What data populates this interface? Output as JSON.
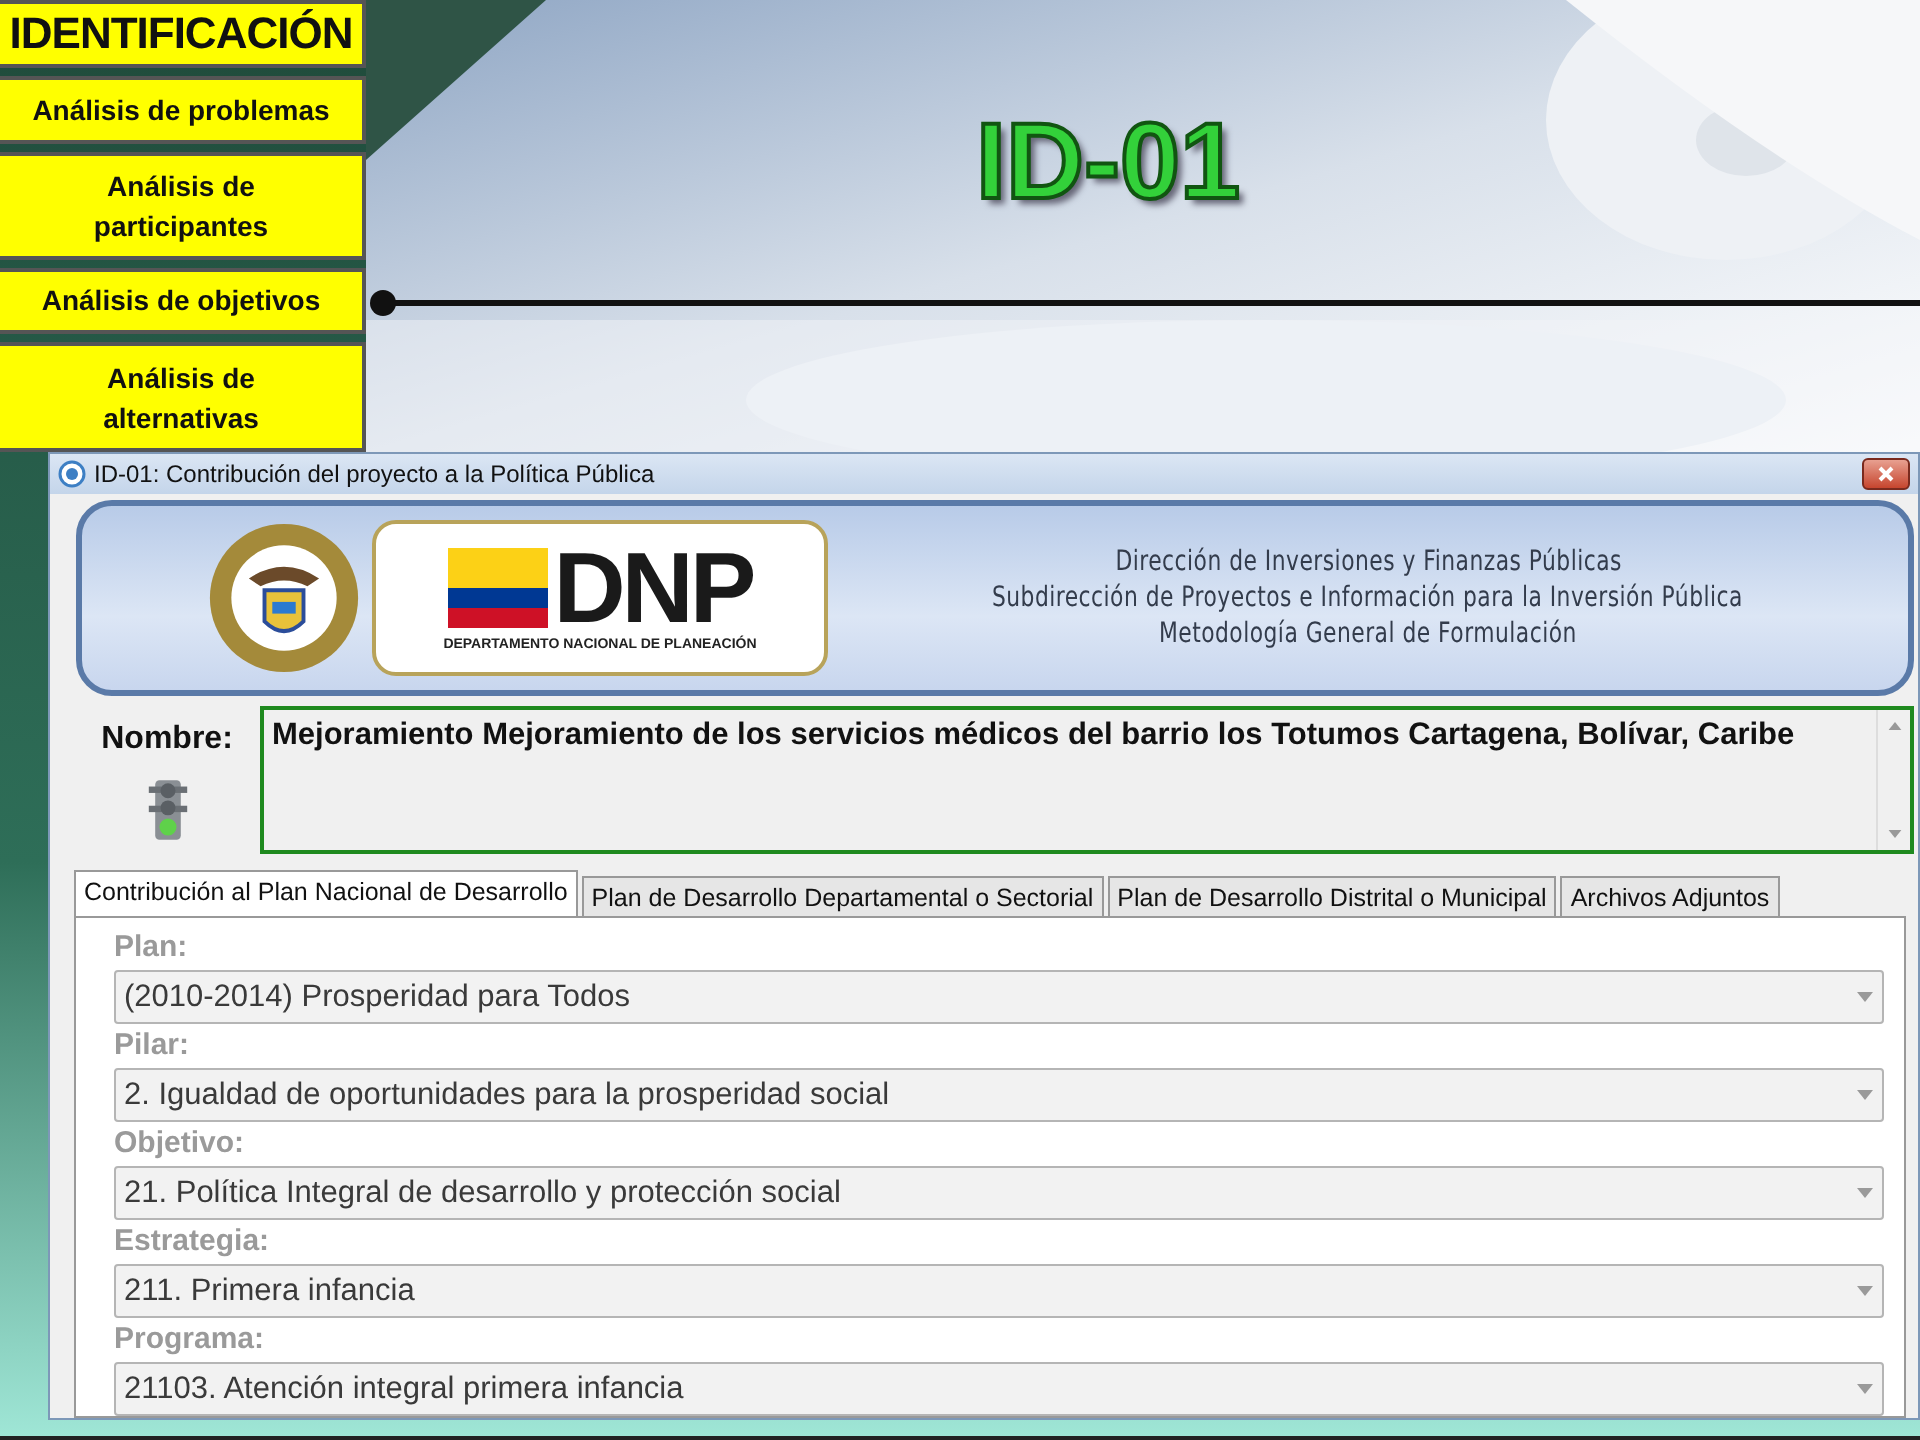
{
  "side_menu": {
    "title": "IDENTIFICACIÓN",
    "items": [
      {
        "label": "Análisis de problemas"
      },
      {
        "label": "Análisis de participantes"
      },
      {
        "label": "Análisis de objetivos"
      },
      {
        "label": "Análisis de alternativas"
      }
    ]
  },
  "slide_title": "ID-01",
  "window": {
    "title": "ID-01: Contribución del proyecto a la Política Pública"
  },
  "header": {
    "logo_text": "DNP",
    "logo_caption": "DEPARTAMENTO NACIONAL DE PLANEACIÓN",
    "lines": [
      "Dirección de Inversiones y Finanzas Públicas",
      "Subdirección de Proyectos e Información para la Inversión Pública",
      "Metodología General de Formulación"
    ]
  },
  "name": {
    "label": "Nombre:",
    "value": "Mejoramiento Mejoramiento de los servicios médicos del barrio los Totumos Cartagena, Bolívar, Caribe"
  },
  "tabs": [
    {
      "label": "Contribución al Plan Nacional de Desarrollo",
      "selected": true
    },
    {
      "label": "Plan de Desarrollo Departamental o Sectorial",
      "selected": false
    },
    {
      "label": "Plan de Desarrollo Distrital o Municipal",
      "selected": false
    },
    {
      "label": "Archivos Adjuntos",
      "selected": false
    }
  ],
  "fields": [
    {
      "label": "Plan:",
      "value": "(2010-2014) Prosperidad para Todos",
      "disabled": true
    },
    {
      "label": "Pilar:",
      "value": "2. Igualdad de oportunidades para la prosperidad social",
      "disabled": true
    },
    {
      "label": "Objetivo:",
      "value": "21. Política Integral de desarrollo y protección social",
      "disabled": true
    },
    {
      "label": "Estrategia:",
      "value": "211. Primera infancia",
      "disabled": true
    },
    {
      "label": "Programa:",
      "value": "21103. Atención integral primera infancia",
      "disabled": true
    }
  ]
}
